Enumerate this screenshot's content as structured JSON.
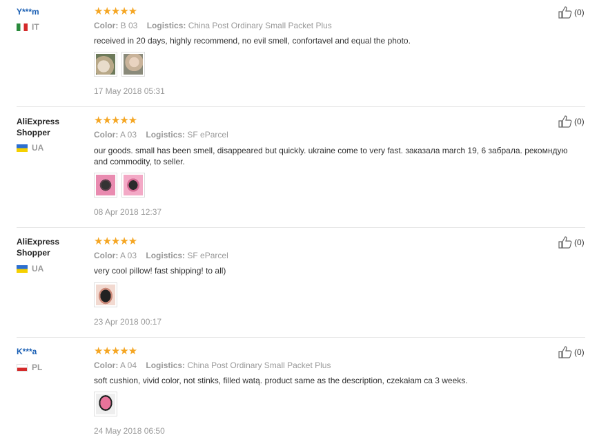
{
  "reviews": [
    {
      "user": "Y***m",
      "country": "IT",
      "stars": "★★★★★",
      "color_label": "Color:",
      "color_value": "B 03",
      "logistics_label": "Logistics:",
      "logistics_value": "China Post Ordinary Small Packet Plus",
      "text": "received in 20 days, highly recommend, no evil smell, confortavel and equal the photo.",
      "date": "17 May 2018 05:31",
      "likes": "(0)"
    },
    {
      "user": "AliExpress Shopper",
      "country": "UA",
      "stars": "★★★★★",
      "color_label": "Color:",
      "color_value": "A 03",
      "logistics_label": "Logistics:",
      "logistics_value": "SF eParcel",
      "text": "our goods. small has been smell, disappeared but quickly. ukraine come to very fast. заказала march 19, 6 забрала. рекомндую and commodity, to seller.",
      "date": "08 Apr 2018 12:37",
      "likes": "(0)"
    },
    {
      "user": "AliExpress Shopper",
      "country": "UA",
      "stars": "★★★★★",
      "color_label": "Color:",
      "color_value": "A 03",
      "logistics_label": "Logistics:",
      "logistics_value": "SF eParcel",
      "text": "very cool pillow! fast shipping! to all)",
      "date": "23 Apr 2018 00:17",
      "likes": "(0)"
    },
    {
      "user": "K***a",
      "country": "PL",
      "stars": "★★★★★",
      "color_label": "Color:",
      "color_value": "A 04",
      "logistics_label": "Logistics:",
      "logistics_value": "China Post Ordinary Small Packet Plus",
      "text": "soft cushion, vivid color, not stinks, filled watą. product same as the description, czekałam ca 3 weeks.",
      "date": "24 May 2018 06:50",
      "likes": "(0)"
    }
  ],
  "icons": {
    "like": "thumbs-up-icon",
    "star": "star-icon"
  },
  "colors": {
    "link": "#1a5fb4",
    "star": "#f5a623",
    "muted": "#999999"
  }
}
